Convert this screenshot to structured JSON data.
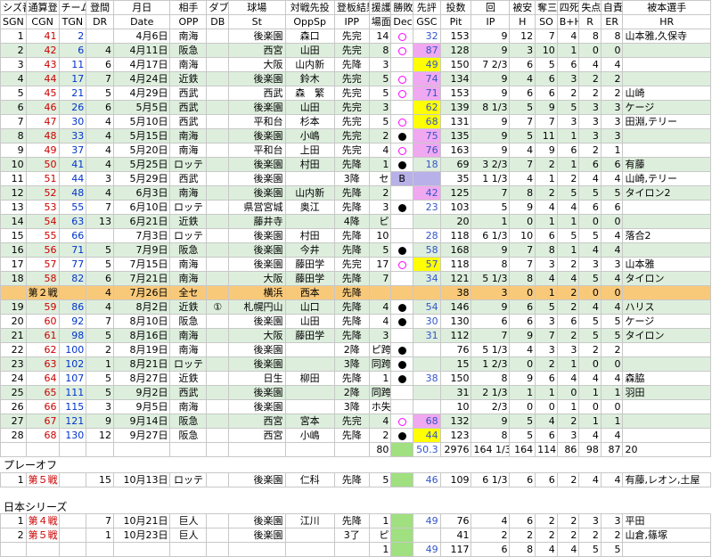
{
  "header1": [
    "シズ番",
    "通算登",
    "チーム登",
    "登間",
    "月日",
    "相手",
    "ダブル",
    "球場",
    "対戦先投",
    "登板結果",
    "援護",
    "勝敗",
    "先評",
    "投数",
    "回",
    "被安",
    "奪三",
    "四死",
    "失点",
    "自責",
    "被本選手"
  ],
  "header2": [
    "SGN",
    "CGN",
    "TGN",
    "DR",
    "Date",
    "OPP",
    "DB",
    "St",
    "OppSp",
    "IPP",
    "場面",
    "Dec",
    "GSC",
    "Pit",
    "IP",
    "H",
    "SO",
    "B+H",
    "R",
    "ER",
    "HR"
  ],
  "rows": [
    {
      "sgn": "1",
      "cgn": "41",
      "tgn": "2",
      "dr": "",
      "date": "4月6日",
      "opp": "南海",
      "db": "",
      "st": "後楽園",
      "oppsp": "森口",
      "ipp": "先完",
      "sc": "14",
      "dec": "circle",
      "gsc": "32",
      "gscc": "",
      "pit": "153",
      "ip": "9",
      "h": "12",
      "so": "7",
      "bh": "4",
      "r": "8",
      "er": "8",
      "hr": "山本雅,久保寺"
    },
    {
      "sgn": "2",
      "cgn": "42",
      "tgn": "6",
      "dr": "4",
      "date": "4月11日",
      "opp": "阪急",
      "db": "",
      "st": "西宮",
      "oppsp": "山田",
      "ipp": "先完",
      "sc": "8",
      "dec": "circle",
      "gsc": "87",
      "gscc": "p",
      "pit": "128",
      "ip": "9",
      "h": "3",
      "so": "10",
      "bh": "1",
      "r": "0",
      "er": "0",
      "hr": ""
    },
    {
      "sgn": "3",
      "cgn": "43",
      "tgn": "11",
      "dr": "6",
      "date": "4月17日",
      "opp": "南海",
      "db": "",
      "st": "大阪",
      "oppsp": "山内新",
      "ipp": "先降",
      "sc": "3",
      "dec": "",
      "gsc": "49",
      "gscc": "y",
      "pit": "150",
      "ip": "7 2/3",
      "h": "6",
      "so": "5",
      "bh": "6",
      "r": "4",
      "er": "4",
      "hr": ""
    },
    {
      "sgn": "4",
      "cgn": "44",
      "tgn": "17",
      "dr": "7",
      "date": "4月24日",
      "opp": "近鉄",
      "db": "",
      "st": "後楽園",
      "oppsp": "鈴木",
      "ipp": "先完",
      "sc": "5",
      "dec": "circle",
      "gsc": "74",
      "gscc": "p",
      "pit": "134",
      "ip": "9",
      "h": "4",
      "so": "6",
      "bh": "3",
      "r": "2",
      "er": "2",
      "hr": ""
    },
    {
      "sgn": "5",
      "cgn": "45",
      "tgn": "21",
      "dr": "5",
      "date": "4月29日",
      "opp": "西武",
      "db": "",
      "st": "西武",
      "oppsp": "森　繁",
      "ipp": "先完",
      "sc": "5",
      "dec": "circle",
      "gsc": "71",
      "gscc": "p",
      "pit": "153",
      "ip": "9",
      "h": "6",
      "so": "6",
      "bh": "2",
      "r": "2",
      "er": "2",
      "hr": "山崎"
    },
    {
      "sgn": "6",
      "cgn": "46",
      "tgn": "26",
      "dr": "6",
      "date": "5月5日",
      "opp": "西武",
      "db": "",
      "st": "後楽園",
      "oppsp": "山田",
      "ipp": "先完",
      "sc": "3",
      "dec": "",
      "gsc": "62",
      "gscc": "y",
      "pit": "139",
      "ip": "8 1/3",
      "h": "5",
      "so": "9",
      "bh": "5",
      "r": "3",
      "er": "3",
      "hr": "ケージ"
    },
    {
      "sgn": "7",
      "cgn": "47",
      "tgn": "30",
      "dr": "4",
      "date": "5月10日",
      "opp": "西武",
      "db": "",
      "st": "平和台",
      "oppsp": "杉本",
      "ipp": "先完",
      "sc": "5",
      "dec": "circle",
      "gsc": "68",
      "gscc": "y",
      "pit": "131",
      "ip": "9",
      "h": "7",
      "so": "7",
      "bh": "3",
      "r": "3",
      "er": "3",
      "hr": "田淵,テリー"
    },
    {
      "sgn": "8",
      "cgn": "48",
      "tgn": "33",
      "dr": "4",
      "date": "5月15日",
      "opp": "南海",
      "db": "",
      "st": "後楽園",
      "oppsp": "小嶋",
      "ipp": "先完",
      "sc": "2",
      "dec": "dot",
      "gsc": "75",
      "gscc": "p",
      "pit": "135",
      "ip": "9",
      "h": "5",
      "so": "11",
      "bh": "1",
      "r": "3",
      "er": "3",
      "hr": ""
    },
    {
      "sgn": "9",
      "cgn": "49",
      "tgn": "37",
      "dr": "4",
      "date": "5月20日",
      "opp": "南海",
      "db": "",
      "st": "平和台",
      "oppsp": "上田",
      "ipp": "先完",
      "sc": "4",
      "dec": "circle",
      "gsc": "76",
      "gscc": "p",
      "pit": "163",
      "ip": "9",
      "h": "4",
      "so": "9",
      "bh": "6",
      "r": "2",
      "er": "1",
      "hr": ""
    },
    {
      "sgn": "10",
      "cgn": "50",
      "tgn": "41",
      "dr": "4",
      "date": "5月25日",
      "opp": "ロッテ",
      "db": "",
      "st": "後楽園",
      "oppsp": "村田",
      "ipp": "先降",
      "sc": "1",
      "dec": "dot",
      "gsc": "18",
      "gscc": "",
      "pit": "69",
      "ip": "3 2/3",
      "h": "7",
      "so": "2",
      "bh": "1",
      "r": "6",
      "er": "6",
      "hr": "有藤"
    },
    {
      "sgn": "11",
      "cgn": "51",
      "tgn": "44",
      "dr": "3",
      "date": "5月29日",
      "opp": "西武",
      "db": "",
      "st": "後楽園",
      "oppsp": "",
      "ipp": "3降",
      "sc": "セ",
      "dec": "B",
      "gsc": "",
      "gscc": "l",
      "pit": "35",
      "ip": "1 1/3",
      "h": "4",
      "so": "1",
      "bh": "2",
      "r": "4",
      "er": "4",
      "hr": "山崎,テリー"
    },
    {
      "sgn": "12",
      "cgn": "52",
      "tgn": "48",
      "dr": "4",
      "date": "6月3日",
      "opp": "南海",
      "db": "",
      "st": "後楽園",
      "oppsp": "山内新",
      "ipp": "先降",
      "sc": "2",
      "dec": "",
      "gsc": "42",
      "gscc": "p",
      "pit": "125",
      "ip": "7",
      "h": "8",
      "so": "2",
      "bh": "5",
      "r": "5",
      "er": "5",
      "hr": "タイロン2"
    },
    {
      "sgn": "13",
      "cgn": "53",
      "tgn": "55",
      "dr": "7",
      "date": "6月10日",
      "opp": "ロッテ",
      "db": "",
      "st": "県営宮城",
      "oppsp": "奥江",
      "ipp": "先降",
      "sc": "3",
      "dec": "dot",
      "gsc": "23",
      "gscc": "",
      "pit": "103",
      "ip": "5",
      "h": "9",
      "so": "4",
      "bh": "4",
      "r": "6",
      "er": "6",
      "hr": ""
    },
    {
      "sgn": "14",
      "cgn": "54",
      "tgn": "63",
      "dr": "13",
      "date": "6月21日",
      "opp": "近鉄",
      "db": "",
      "st": "藤井寺",
      "oppsp": "",
      "ipp": "4降",
      "sc": "ピ",
      "dec": "",
      "gsc": "",
      "gscc": "",
      "pit": "20",
      "ip": "1",
      "h": "0",
      "so": "1",
      "bh": "1",
      "r": "0",
      "er": "0",
      "hr": ""
    },
    {
      "sgn": "15",
      "cgn": "55",
      "tgn": "66",
      "dr": "",
      "date": "7月3日",
      "opp": "ロッテ",
      "db": "",
      "st": "後楽園",
      "oppsp": "村田",
      "ipp": "先降",
      "sc": "10",
      "dec": "",
      "gsc": "28",
      "gscc": "",
      "pit": "118",
      "ip": "6 1/3",
      "h": "10",
      "so": "6",
      "bh": "5",
      "r": "5",
      "er": "4",
      "hr": "落合2"
    },
    {
      "sgn": "16",
      "cgn": "56",
      "tgn": "71",
      "dr": "5",
      "date": "7月9日",
      "opp": "阪急",
      "db": "",
      "st": "後楽園",
      "oppsp": "今井",
      "ipp": "先降",
      "sc": "5",
      "dec": "dot",
      "gsc": "58",
      "gscc": "",
      "pit": "168",
      "ip": "9",
      "h": "7",
      "so": "8",
      "bh": "1",
      "r": "4",
      "er": "4",
      "hr": ""
    },
    {
      "sgn": "17",
      "cgn": "57",
      "tgn": "77",
      "dr": "5",
      "date": "7月15日",
      "opp": "南海",
      "db": "",
      "st": "後楽園",
      "oppsp": "藤田学",
      "ipp": "先完",
      "sc": "17",
      "dec": "circle",
      "gsc": "57",
      "gscc": "y",
      "pit": "118",
      "ip": "8",
      "h": "7",
      "so": "3",
      "bh": "2",
      "r": "3",
      "er": "3",
      "hr": "山本雅"
    },
    {
      "sgn": "18",
      "cgn": "58",
      "tgn": "82",
      "dr": "6",
      "date": "7月21日",
      "opp": "南海",
      "db": "",
      "st": "大阪",
      "oppsp": "藤田学",
      "ipp": "先降",
      "sc": "7",
      "dec": "",
      "gsc": "34",
      "gscc": "",
      "pit": "121",
      "ip": "5 1/3",
      "h": "8",
      "so": "4",
      "bh": "4",
      "r": "5",
      "er": "4",
      "hr": "タイロン"
    },
    {
      "allstar": true,
      "sgn": "",
      "cgn": "第２戦",
      "tgn": "",
      "dr": "4",
      "date": "7月26日",
      "opp": "全セ",
      "db": "",
      "st": "横浜",
      "oppsp": "西本",
      "ipp": "先降",
      "sc": "",
      "dec": "",
      "gsc": "",
      "gscc": "",
      "pit": "38",
      "ip": "3",
      "h": "0",
      "so": "1",
      "bh": "2",
      "r": "0",
      "er": "0",
      "hr": ""
    },
    {
      "sgn": "19",
      "cgn": "59",
      "tgn": "86",
      "dr": "4",
      "date": "8月2日",
      "opp": "近鉄",
      "db": "①",
      "st": "札幌円山",
      "oppsp": "山口",
      "ipp": "先降",
      "sc": "4",
      "dec": "dot",
      "gsc": "54",
      "gscc": "",
      "pit": "146",
      "ip": "9",
      "h": "6",
      "so": "5",
      "bh": "2",
      "r": "4",
      "er": "4",
      "hr": "ハリス"
    },
    {
      "sgn": "20",
      "cgn": "60",
      "tgn": "92",
      "dr": "7",
      "date": "8月10日",
      "opp": "阪急",
      "db": "",
      "st": "後楽園",
      "oppsp": "山田",
      "ipp": "先降",
      "sc": "4",
      "dec": "dot",
      "gsc": "30",
      "gscc": "",
      "pit": "130",
      "ip": "6",
      "h": "6",
      "so": "3",
      "bh": "6",
      "r": "5",
      "er": "5",
      "hr": "ケージ"
    },
    {
      "sgn": "21",
      "cgn": "61",
      "tgn": "98",
      "dr": "5",
      "date": "8月16日",
      "opp": "南海",
      "db": "",
      "st": "大阪",
      "oppsp": "藤田学",
      "ipp": "先降",
      "sc": "3",
      "dec": "",
      "gsc": "31",
      "gscc": "",
      "pit": "112",
      "ip": "7",
      "h": "9",
      "so": "7",
      "bh": "2",
      "r": "5",
      "er": "5",
      "hr": "タイロン"
    },
    {
      "sgn": "22",
      "cgn": "62",
      "tgn": "100",
      "dr": "2",
      "date": "8月19日",
      "opp": "南海",
      "db": "",
      "st": "後楽園",
      "oppsp": "",
      "ipp": "2降",
      "sc": "ピ跨",
      "dec": "dot",
      "gsc": "",
      "gscc": "",
      "pit": "76",
      "ip": "5 1/3",
      "h": "4",
      "so": "3",
      "bh": "3",
      "r": "2",
      "er": "2",
      "hr": ""
    },
    {
      "sgn": "23",
      "cgn": "63",
      "tgn": "102",
      "dr": "1",
      "date": "8月21日",
      "opp": "ロッテ",
      "db": "",
      "st": "後楽園",
      "oppsp": "",
      "ipp": "3降",
      "sc": "同跨",
      "dec": "dot",
      "gsc": "",
      "gscc": "",
      "pit": "15",
      "ip": "1 2/3",
      "h": "0",
      "so": "2",
      "bh": "1",
      "r": "0",
      "er": "0",
      "hr": ""
    },
    {
      "sgn": "24",
      "cgn": "64",
      "tgn": "107",
      "dr": "5",
      "date": "8月27日",
      "opp": "近鉄",
      "db": "",
      "st": "日生",
      "oppsp": "柳田",
      "ipp": "先降",
      "sc": "1",
      "dec": "dot",
      "gsc": "38",
      "gscc": "",
      "pit": "150",
      "ip": "8",
      "h": "9",
      "so": "6",
      "bh": "4",
      "r": "4",
      "er": "4",
      "hr": "森脇"
    },
    {
      "sgn": "25",
      "cgn": "65",
      "tgn": "111",
      "dr": "5",
      "date": "9月2日",
      "opp": "西武",
      "db": "",
      "st": "後楽園",
      "oppsp": "",
      "ipp": "2降",
      "sc": "同跨",
      "dec": "",
      "gsc": "",
      "gscc": "",
      "pit": "31",
      "ip": "2 1/3",
      "h": "1",
      "so": "1",
      "bh": "0",
      "r": "1",
      "er": "1",
      "hr": "羽田"
    },
    {
      "sgn": "26",
      "cgn": "66",
      "tgn": "115",
      "dr": "3",
      "date": "9月5日",
      "opp": "南海",
      "db": "",
      "st": "後楽園",
      "oppsp": "",
      "ipp": "3降",
      "sc": "ホ失",
      "dec": "",
      "gsc": "",
      "gscc": "",
      "pit": "10",
      "ip": "2/3",
      "h": "0",
      "so": "0",
      "bh": "1",
      "r": "0",
      "er": "0",
      "hr": ""
    },
    {
      "sgn": "27",
      "cgn": "67",
      "tgn": "121",
      "dr": "9",
      "date": "9月14日",
      "opp": "阪急",
      "db": "",
      "st": "西宮",
      "oppsp": "宮本",
      "ipp": "先完",
      "sc": "4",
      "dec": "circle",
      "gsc": "68",
      "gscc": "p",
      "pit": "132",
      "ip": "9",
      "h": "5",
      "so": "4",
      "bh": "2",
      "r": "1",
      "er": "1",
      "hr": ""
    },
    {
      "sgn": "28",
      "cgn": "68",
      "tgn": "130",
      "dr": "12",
      "date": "9月27日",
      "opp": "阪急",
      "db": "",
      "st": "西宮",
      "oppsp": "小嶋",
      "ipp": "先降",
      "sc": "2",
      "dec": "dot",
      "gsc": "44",
      "gscc": "y",
      "pit": "123",
      "ip": "8",
      "h": "5",
      "so": "6",
      "bh": "3",
      "r": "4",
      "er": "4",
      "hr": ""
    }
  ],
  "totals": {
    "sc": "80",
    "gsc": "50.3",
    "pit": "2976",
    "ip": "164 1/3",
    "h": "164",
    "so": "114",
    "bh": "86",
    "r": "98",
    "er": "87",
    "hr": "20"
  },
  "playoff": {
    "title": "プレーオフ",
    "row": {
      "sgn": "1",
      "cgn": "第５戦",
      "dr": "15",
      "date": "10月13日",
      "opp": "ロッテ",
      "st": "後楽園",
      "oppsp": "仁科",
      "ipp": "先降",
      "sc": "5",
      "gsc": "46",
      "pit": "109",
      "ip": "6 1/3",
      "h": "6",
      "so": "6",
      "bh": "2",
      "r": "4",
      "er": "4",
      "hr": "有藤,レオン,土屋"
    }
  },
  "series": {
    "title": "日本シリーズ",
    "rows": [
      {
        "sgn": "1",
        "cgn": "第４戦",
        "dr": "7",
        "date": "10月21日",
        "opp": "巨人",
        "st": "後楽園",
        "oppsp": "江川",
        "ipp": "先降",
        "sc": "1",
        "gsc": "49",
        "pit": "76",
        "ip": "4",
        "h": "6",
        "so": "2",
        "bh": "2",
        "r": "3",
        "er": "3",
        "hr": "平田"
      },
      {
        "sgn": "2",
        "cgn": "第５戦",
        "dr": "1",
        "date": "10月23日",
        "opp": "巨人",
        "st": "後楽園",
        "oppsp": "",
        "ipp": "3了",
        "sc": "ピ",
        "gsc": "",
        "pit": "41",
        "ip": "2",
        "h": "2",
        "so": "2",
        "bh": "2",
        "r": "2",
        "er": "2",
        "hr": "山倉,篠塚"
      }
    ],
    "totals": {
      "sc": "1",
      "gsc": "49",
      "pit": "117",
      "ip": "6",
      "h": "8",
      "so": "4",
      "bh": "4",
      "r": "5",
      "er": "5",
      "hr": ""
    }
  },
  "colors": {
    "cgn": "#cc0000",
    "tgn": "#0033cc",
    "gsc": "#3355cc",
    "high": "#f0a8f0",
    "mid": "#ffff00",
    "stripe": "#ddeedd",
    "allstar": "#f9c97a",
    "green": "#a0e080"
  }
}
